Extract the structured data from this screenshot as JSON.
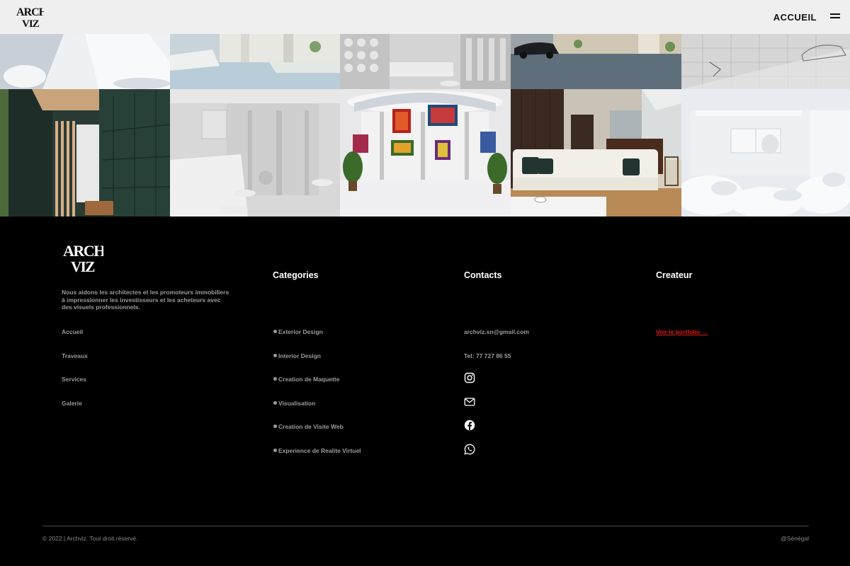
{
  "header": {
    "logo_text_top": "ARCH",
    "logo_text_bottom": "VIZ",
    "nav_label": "ACCUEIL",
    "menu_icon": "hamburger-icon"
  },
  "gallery": {
    "tiles": [
      {
        "name": "exterior-white-terrace-render"
      },
      {
        "name": "exterior-car-driveway-render"
      },
      {
        "name": "white-model-perforated-wall-render"
      },
      {
        "name": "exterior-parking-dark-car-render"
      },
      {
        "name": "wireframe-parking-car-render"
      },
      {
        "name": "dark-green-lobby-wooden-slats-render"
      },
      {
        "name": "white-model-kitchen-counter-render"
      },
      {
        "name": "art-gallery-interior-render"
      },
      {
        "name": "living-room-white-sofa-render"
      },
      {
        "name": "white-model-exterior-plants-render"
      }
    ]
  },
  "footer": {
    "logo_text_top": "ARCH",
    "logo_text_bottom": "VIZ",
    "description": "Nous aidons les architectes et les promoteurs immobiliers à impressionner les investisseurs et les acheteurs avec des visuels professionnels.",
    "nav_links": [
      "Accueil",
      "Traveaux",
      "Services",
      "Galerie"
    ],
    "categories": {
      "title": "Categories",
      "items": [
        "Exterior Design",
        "Interior Design",
        "Creation de Maquette",
        "Visualisation",
        "Creation de Visite Web",
        "Experience de Realite Virtuel"
      ]
    },
    "contacts": {
      "title": "Contacts",
      "email": "archviz.sn@gmail.com",
      "phone": "Tel: 77 727 86 55",
      "social_icons": [
        "instagram-icon",
        "mail-icon",
        "facebook-icon",
        "whatsapp-icon"
      ]
    },
    "creator": {
      "title": "Createur",
      "link_label": "Voir le portfolio",
      "link_arrow": "→",
      "link_color": "#e01b1b"
    },
    "copyright": "© 2022 | Archviz. Tout droit réservé.",
    "country": "@Sénégal"
  }
}
